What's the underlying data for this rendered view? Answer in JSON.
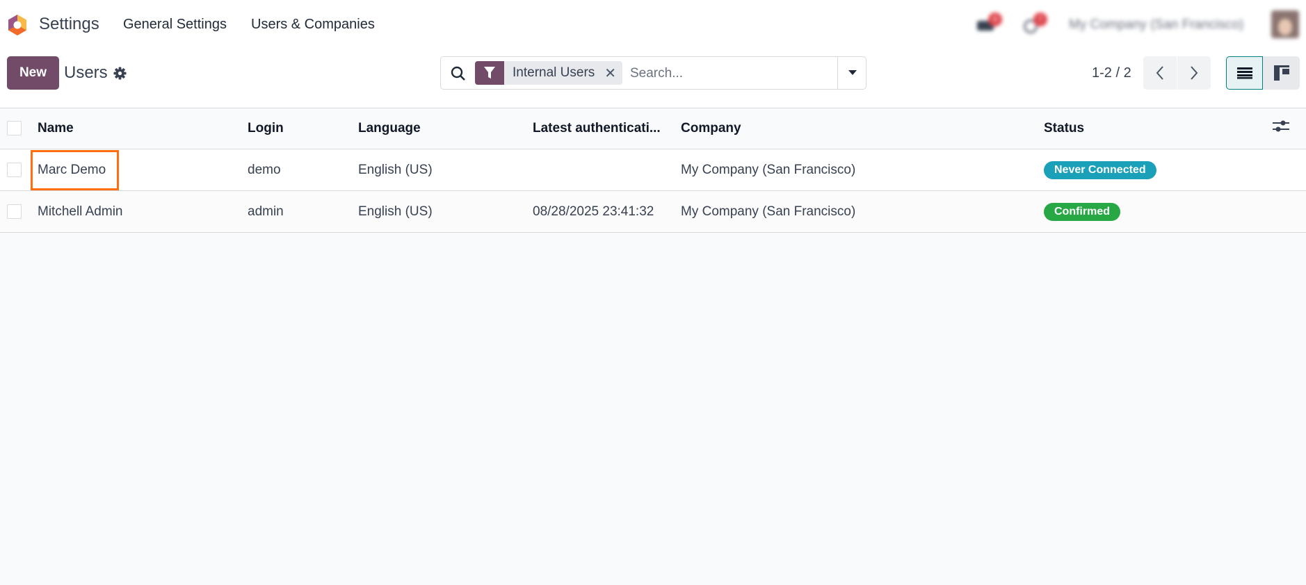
{
  "navbar": {
    "app_name": "Settings",
    "menu": [
      "General Settings",
      "Users & Companies"
    ],
    "company": "My Company (San Francisco)",
    "messages_count": "9",
    "activities_count": "7"
  },
  "control": {
    "new_label": "New",
    "title": "Users",
    "search": {
      "facet": "Internal Users",
      "placeholder": "Search..."
    },
    "pager": "1-2 / 2"
  },
  "table": {
    "columns": [
      "Name",
      "Login",
      "Language",
      "Latest authenticati...",
      "Company",
      "Status"
    ],
    "rows": [
      {
        "name": "Marc Demo",
        "login": "demo",
        "language": "English (US)",
        "latest_auth": "",
        "company": "My Company (San Francisco)",
        "status": "Never Connected",
        "status_color": "#17a2b8"
      },
      {
        "name": "Mitchell Admin",
        "login": "admin",
        "language": "English (US)",
        "latest_auth": "08/28/2025 23:41:32",
        "company": "My Company (San Francisco)",
        "status": "Confirmed",
        "status_color": "#28a745"
      }
    ]
  },
  "colors": {
    "brand": "#714b67",
    "highlight": "#ff6f0f"
  }
}
